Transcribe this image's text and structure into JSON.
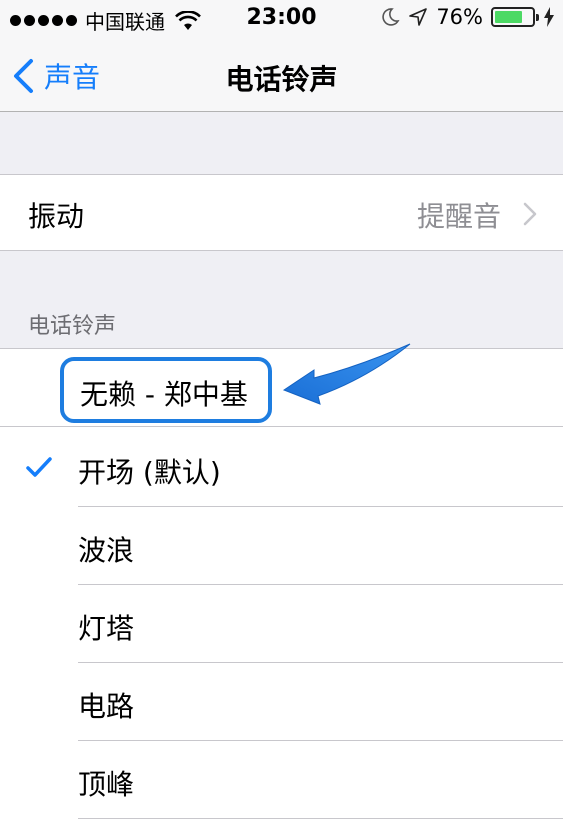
{
  "status_bar": {
    "carrier": "中国联通",
    "time": "23:00",
    "battery_percent": "76%",
    "battery_level": 0.76,
    "icons": [
      "signal-dots",
      "wifi-icon",
      "moon-icon",
      "location-icon",
      "battery-icon",
      "bolt-icon"
    ]
  },
  "nav": {
    "back_label": "声音",
    "title": "电话铃声"
  },
  "vibration": {
    "label": "振动",
    "value": "提醒音"
  },
  "ringtones": {
    "section_header": "电话铃声",
    "custom_item": "无赖 - 郑中基",
    "items": [
      {
        "label": "开场 (默认)",
        "checked": true
      },
      {
        "label": "波浪",
        "checked": false
      },
      {
        "label": "灯塔",
        "checked": false
      },
      {
        "label": "电路",
        "checked": false
      },
      {
        "label": "顶峰",
        "checked": false
      }
    ]
  },
  "colors": {
    "accent": "#157efb",
    "annotation": "#1e7de0",
    "background": "#efeff4",
    "battery": "#4cd964"
  }
}
